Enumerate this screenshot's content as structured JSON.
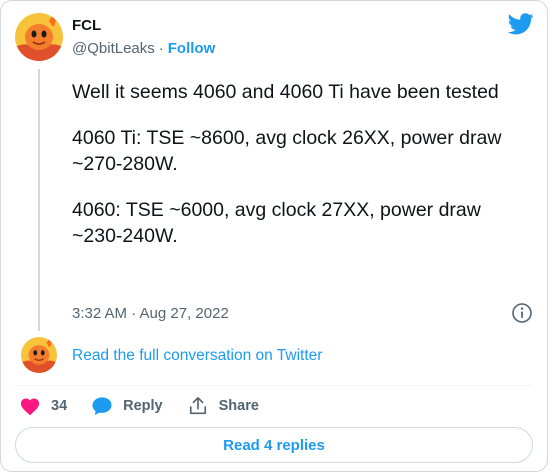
{
  "author": {
    "name": "FCL",
    "handle": "@QbitLeaks",
    "follow_label": "Follow",
    "separator": "·"
  },
  "tweet": {
    "paragraphs": [
      "Well it seems 4060 and 4060 Ti have been tested",
      "4060 Ti: TSE ~8600, avg clock 26XX, power draw ~270-280W.",
      "4060: TSE ~6000, avg clock 27XX, power draw ~230-240W."
    ],
    "timestamp": "3:32 AM · Aug 27, 2022"
  },
  "conversation_link": "Read the full conversation on Twitter",
  "actions": {
    "like_count": "34",
    "reply_label": "Reply",
    "share_label": "Share"
  },
  "read_replies_label": "Read 4 replies",
  "colors": {
    "accent": "#1d9bf0",
    "like": "#f91880",
    "secondary_text": "#536471",
    "border": "#cfd9de"
  },
  "icons": {
    "brand": "twitter-bird-icon",
    "info": "info-icon",
    "like": "heart-icon",
    "reply": "speech-bubble-icon",
    "share": "share-icon"
  }
}
